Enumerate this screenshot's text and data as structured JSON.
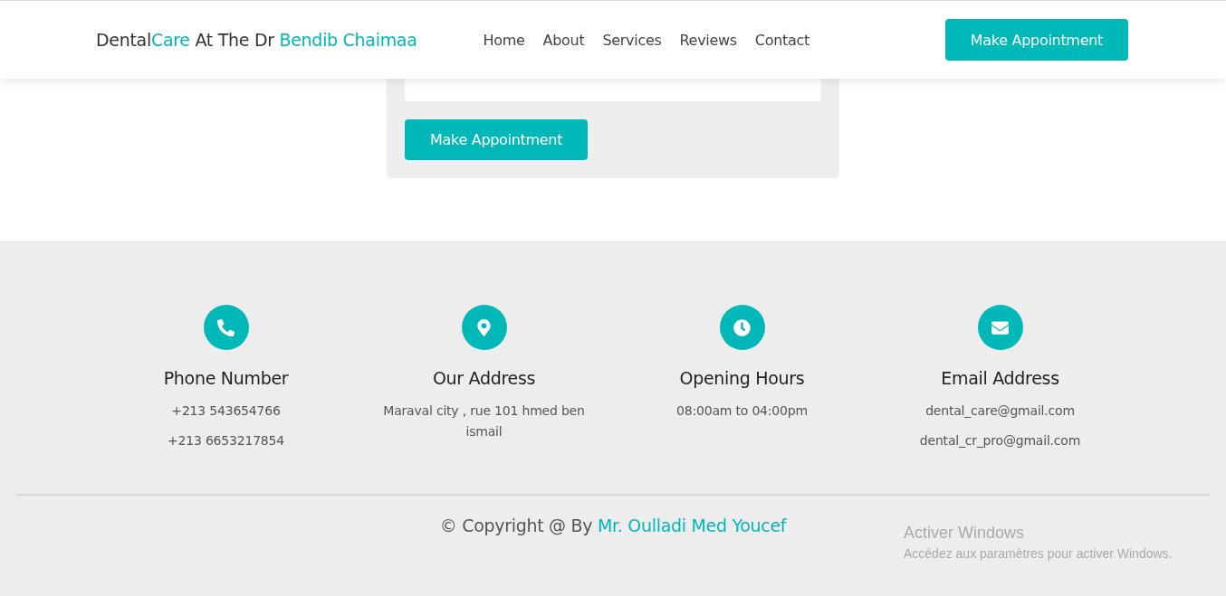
{
  "header": {
    "brand": [
      {
        "text": "Dental",
        "accent": false
      },
      {
        "text": "Care",
        "accent": true
      },
      {
        "text": " At The Dr ",
        "accent": false
      },
      {
        "text": "Bendib Chaimaa",
        "accent": true
      }
    ],
    "nav": [
      "Home",
      "About",
      "Services",
      "Reviews",
      "Contact"
    ],
    "cta": "Make Appointment"
  },
  "form": {
    "submit": "Make Appointment"
  },
  "contacts": [
    {
      "kind": "phone",
      "title": "Phone Number",
      "lines": [
        "+213 543654766",
        "+213 6653217854"
      ]
    },
    {
      "kind": "address",
      "title": "Our Address",
      "lines": [
        "Maraval city , rue 101 hmed ben ismail"
      ]
    },
    {
      "kind": "hours",
      "title": "Opening Hours",
      "lines": [
        "08:00am to 04:00pm"
      ]
    },
    {
      "kind": "email",
      "title": "Email Address",
      "lines": [
        "dental_care@gmail.com",
        "dental_cr_pro@gmail.com"
      ]
    }
  ],
  "copyright": {
    "prefix": "© Copyright @ By ",
    "author": "Mr. Oulladi Med Youcef"
  },
  "activation": {
    "title": "Activer Windows",
    "text": "Accédez aux paramètres pour activer Windows."
  }
}
